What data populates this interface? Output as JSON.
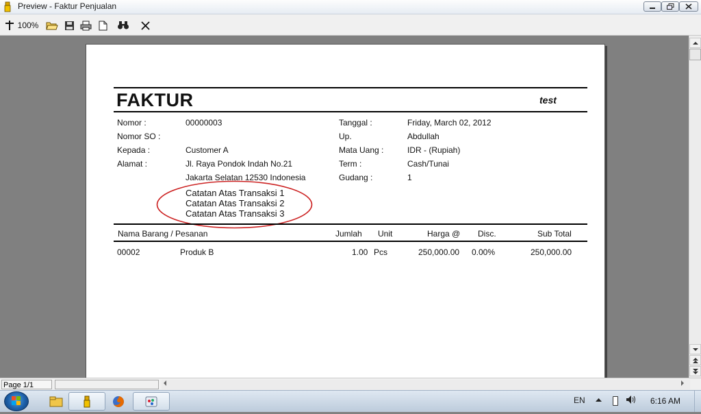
{
  "window": {
    "title": "Preview - Faktur Penjualan"
  },
  "toolbar": {
    "zoom_label": "100%"
  },
  "invoice": {
    "title": "FAKTUR",
    "corner_text": "test",
    "left_fields": [
      {
        "label": "Nomor :",
        "value": "00000003"
      },
      {
        "label": "Nomor SO :",
        "value": ""
      },
      {
        "label": "Kepada :",
        "value": "Customer A"
      },
      {
        "label": "Alamat :",
        "value": "Jl. Raya Pondok Indah No.21"
      }
    ],
    "address_line2": "Jakarta Selatan 12530 Indonesia",
    "right_fields": [
      {
        "label": "Tanggal :",
        "value": "Friday, March 02, 2012"
      },
      {
        "label": "Up.",
        "value": "Abdullah"
      },
      {
        "label": "Mata Uang :",
        "value": "IDR - (Rupiah)"
      },
      {
        "label": "Term :",
        "value": "Cash/Tunai"
      },
      {
        "label": "Gudang :",
        "value": "1"
      }
    ],
    "notes": [
      "Catatan Atas Transaksi 1",
      "Catatan Atas Transaksi 2",
      "Catatan Atas Transaksi 3"
    ],
    "table": {
      "headers": [
        "Nama Barang / Pesanan",
        "Jumlah",
        "Unit",
        "Harga @",
        "Disc.",
        "Sub Total"
      ],
      "rows": [
        {
          "code": "00002",
          "name": "Produk B",
          "qty": "1.00",
          "unit": "Pcs",
          "price": "250,000.00",
          "disc": "0.00%",
          "subtotal": "250,000.00"
        }
      ]
    }
  },
  "status": {
    "page": "Page 1/1"
  },
  "taskbar": {
    "language": "EN",
    "time": "6:16 AM"
  },
  "colors": {
    "annotation": "#cc2222",
    "preview_bg": "#808080"
  }
}
